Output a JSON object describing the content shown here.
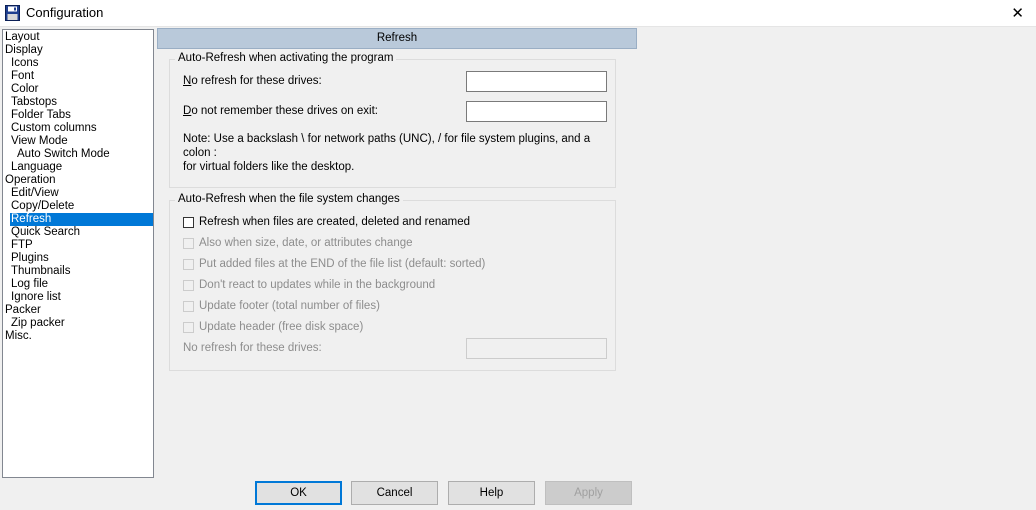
{
  "window": {
    "title": "Configuration",
    "close_glyph": "✕"
  },
  "tree": [
    {
      "label": "Layout",
      "indent": 0
    },
    {
      "label": "Display",
      "indent": 0
    },
    {
      "label": "Icons",
      "indent": 1
    },
    {
      "label": "Font",
      "indent": 1
    },
    {
      "label": "Color",
      "indent": 1
    },
    {
      "label": "Tabstops",
      "indent": 1
    },
    {
      "label": "Folder Tabs",
      "indent": 1
    },
    {
      "label": "Custom columns",
      "indent": 1
    },
    {
      "label": "View Mode",
      "indent": 1
    },
    {
      "label": "Auto Switch Mode",
      "indent": 2
    },
    {
      "label": "Language",
      "indent": 1
    },
    {
      "label": "Operation",
      "indent": 0
    },
    {
      "label": "Edit/View",
      "indent": 1
    },
    {
      "label": "Copy/Delete",
      "indent": 1
    },
    {
      "label": "Refresh",
      "indent": 1,
      "selected": true
    },
    {
      "label": "Quick Search",
      "indent": 1
    },
    {
      "label": "FTP",
      "indent": 1
    },
    {
      "label": "Plugins",
      "indent": 1
    },
    {
      "label": "Thumbnails",
      "indent": 1
    },
    {
      "label": "Log file",
      "indent": 1
    },
    {
      "label": "Ignore list",
      "indent": 1
    },
    {
      "label": "Packer",
      "indent": 0
    },
    {
      "label": "Zip packer",
      "indent": 1
    },
    {
      "label": "Misc.",
      "indent": 0
    }
  ],
  "header": {
    "title": "Refresh"
  },
  "group1": {
    "title": "Auto-Refresh when activating the program",
    "no_refresh_label_key": "N",
    "no_refresh_label_rest": "o refresh for these drives:",
    "no_refresh_value": "",
    "no_remember_label_key": "D",
    "no_remember_label_rest": "o not remember these drives on exit:",
    "no_remember_value": "",
    "note_line1": "Note: Use a backslash \\ for network paths (UNC), / for file system plugins, and a colon :",
    "note_line2": "for virtual folders like the desktop."
  },
  "group2": {
    "title": "Auto-Refresh when the file system changes",
    "options": [
      {
        "label": "Refresh when files are created, deleted and renamed",
        "checked": false,
        "enabled": true
      },
      {
        "label": "Also when size, date, or attributes change",
        "checked": false,
        "enabled": false
      },
      {
        "label": "Put added files at the END of the file list (default: sorted)",
        "checked": false,
        "enabled": false
      },
      {
        "label": "Don't react to updates while in the background",
        "checked": false,
        "enabled": false
      },
      {
        "label": "Update footer (total number of files)",
        "checked": false,
        "enabled": false
      },
      {
        "label": "Update header (free disk space)",
        "checked": false,
        "enabled": false
      }
    ],
    "no_refresh_label": "No refresh for these drives:",
    "no_refresh_value": ""
  },
  "buttons": {
    "ok": "OK",
    "cancel": "Cancel",
    "help": "Help",
    "apply": "Apply"
  },
  "colors": {
    "selection": "#0078d7",
    "header_bg": "#b9c9da"
  }
}
